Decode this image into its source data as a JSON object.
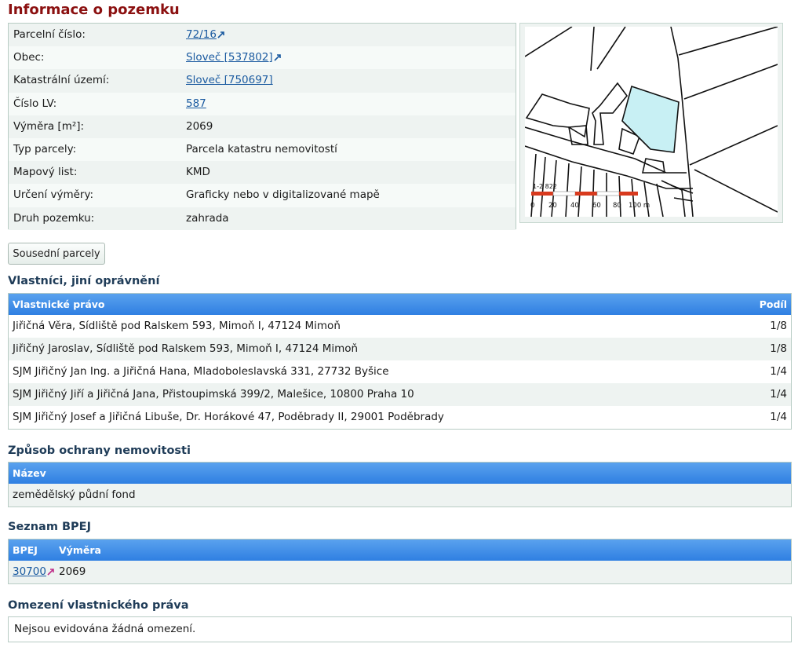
{
  "page_title": "Informace o pozemku",
  "parcel_info": [
    {
      "label": "Parcelní číslo:",
      "value": "72/16",
      "link": true,
      "ext": true
    },
    {
      "label": "Obec:",
      "value": "Sloveč [537802]",
      "link": true,
      "ext": true
    },
    {
      "label": "Katastrální území:",
      "value": "Sloveč [750697]",
      "link": true,
      "ext": false
    },
    {
      "label": "Číslo LV:",
      "value": "587",
      "link": true,
      "ext": false
    },
    {
      "label": "Výměra [m²]:",
      "value": "2069",
      "link": false,
      "ext": false
    },
    {
      "label": "Typ parcely:",
      "value": "Parcela katastru nemovitostí",
      "link": false,
      "ext": false
    },
    {
      "label": "Mapový list:",
      "value": "KMD",
      "link": false,
      "ext": false
    },
    {
      "label": "Určení výměry:",
      "value": "Graficky nebo v digitalizované mapě",
      "link": false,
      "ext": false
    },
    {
      "label": "Druh pozemku:",
      "value": "zahrada",
      "link": false,
      "ext": false
    }
  ],
  "map": {
    "parcel_number_label": "1-2 822",
    "scale_labels": [
      "0",
      "20",
      "40",
      "60",
      "80",
      "100 m"
    ],
    "highlight_color": "#c8f0f4",
    "scale_color": "#d83a1e"
  },
  "neighbors_button": "Sousední parcely",
  "owners": {
    "heading": "Vlastníci, jiní oprávnění",
    "col_right": "Vlastnické právo",
    "col_share": "Podíl",
    "rows": [
      {
        "name": "Jiřičná Věra, Sídliště pod Ralskem 593, Mimoň I, 47124 Mimoň",
        "share": "1/8"
      },
      {
        "name": "Jiřičný Jaroslav, Sídliště pod Ralskem 593, Mimoň I, 47124 Mimoň",
        "share": "1/8"
      },
      {
        "name": "SJM Jiřičný Jan Ing. a Jiřičná Hana, Mladoboleslavská 331, 27732 Byšice",
        "share": "1/4"
      },
      {
        "name": "SJM Jiřičný Jiří a Jiřičná Jana, Přistoupimská 399/2, Malešice, 10800 Praha 10",
        "share": "1/4"
      },
      {
        "name": "SJM Jiřičný Josef a Jiřičná Libuše, Dr. Horákové 47, Poděbrady II, 29001 Poděbrady",
        "share": "1/4"
      }
    ]
  },
  "protection": {
    "heading": "Způsob ochrany nemovitosti",
    "col_name": "Název",
    "value": "zemědělský půdní fond"
  },
  "bpej": {
    "heading": "Seznam BPEJ",
    "col_code": "BPEJ",
    "col_area": "Výměra",
    "code": "30700",
    "area": "2069"
  },
  "restrictions": {
    "heading": "Omezení vlastnického práva",
    "text": "Nejsou evidována žádná omezení."
  },
  "colors": {
    "title": "#8b1010",
    "header_blue": "#2f7fe2",
    "link": "#1a5aa0"
  }
}
